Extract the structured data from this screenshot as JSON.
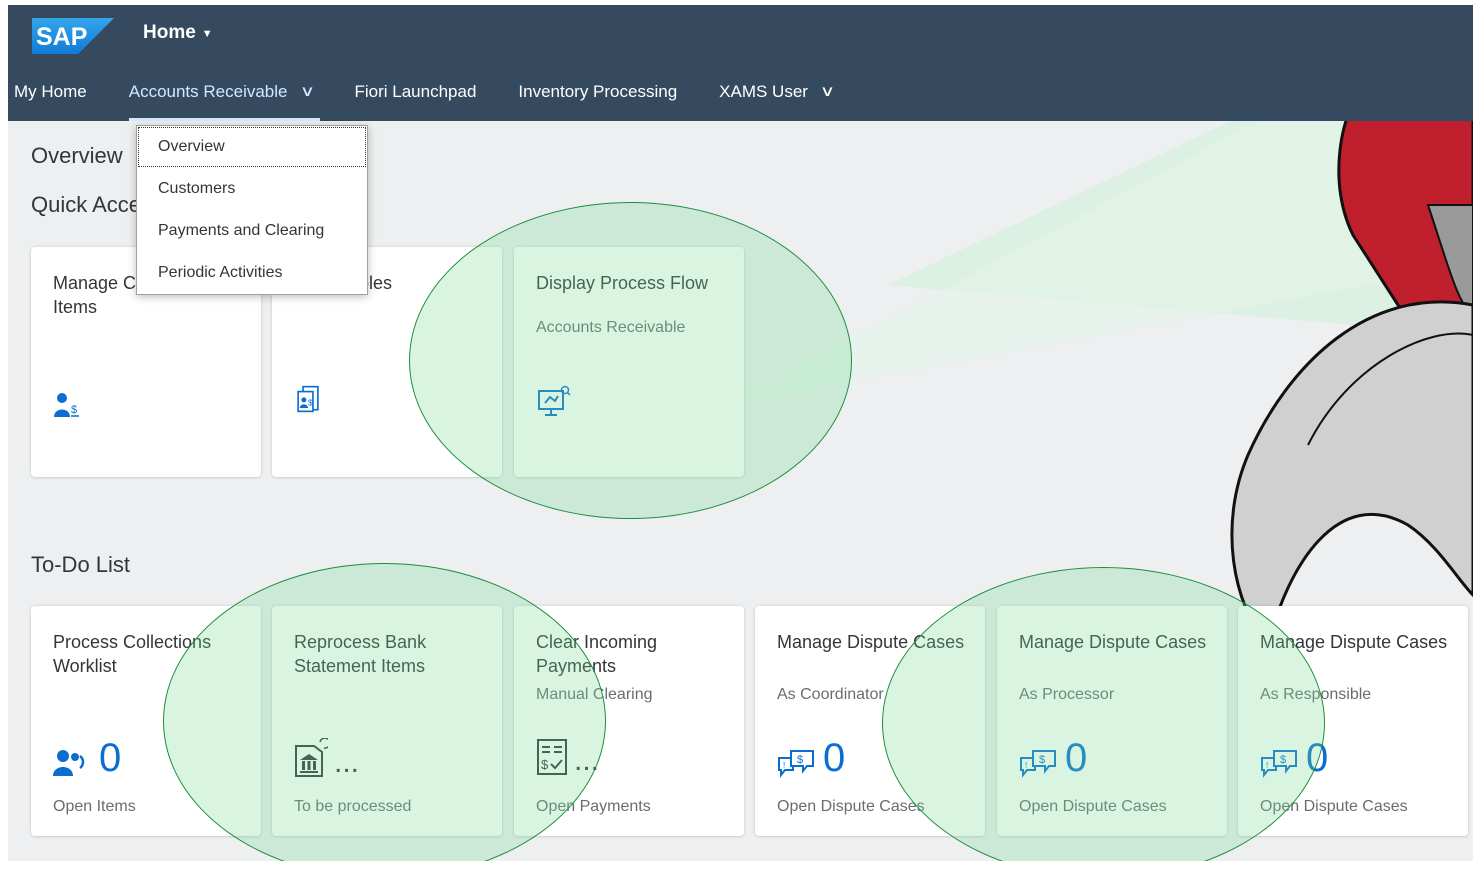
{
  "shell": {
    "logo_text": "SAP",
    "title": "Home",
    "brand_color": "#354a5f",
    "accent_color": "#0a6ed1"
  },
  "tabs": [
    {
      "label": "My Home"
    },
    {
      "label": "Accounts Receivable",
      "active": true
    },
    {
      "label": "Fiori Launchpad"
    },
    {
      "label": "Inventory Processing"
    },
    {
      "label": "XAMS User"
    }
  ],
  "dropdown": {
    "items": [
      "Overview",
      "Customers",
      "Payments and Clearing",
      "Periodic Activities"
    ]
  },
  "sections": {
    "overview": "Overview",
    "quick_access": "Quick Access",
    "todo": "To-Do List"
  },
  "quick_tiles": [
    {
      "title": "Manage Customer Line Items",
      "icon": "customer-money-icon"
    },
    {
      "title": "Receivables",
      "icon": "receivables-document-icon"
    },
    {
      "title": "Display Process Flow",
      "subtitle": "Accounts Receivable",
      "icon": "monitor-search-icon"
    }
  ],
  "todo_tiles": [
    {
      "title": "Process Collections Worklist",
      "subtitle": "",
      "value": "0",
      "footer": "Open Items",
      "icon": "collections-icon"
    },
    {
      "title": "Reprocess Bank Statement Items",
      "subtitle": "",
      "value": "...",
      "footer": "To be processed",
      "icon": "bank-statement-icon"
    },
    {
      "title": "Clear Incoming Payments",
      "subtitle": "Manual Clearing",
      "value": "...",
      "footer": "Open Payments",
      "icon": "payment-document-icon"
    },
    {
      "title": "Manage Dispute Cases",
      "subtitle": "As Coordinator",
      "value": "0",
      "footer": "Open Dispute Cases",
      "icon": "dispute-icon"
    },
    {
      "title": "Manage Dispute Cases",
      "subtitle": "As Processor",
      "value": "0",
      "footer": "Open Dispute Cases",
      "icon": "dispute-icon"
    },
    {
      "title": "Manage Dispute Cases",
      "subtitle": "As Responsible",
      "value": "0",
      "footer": "Open Dispute Cases",
      "icon": "dispute-icon"
    }
  ]
}
